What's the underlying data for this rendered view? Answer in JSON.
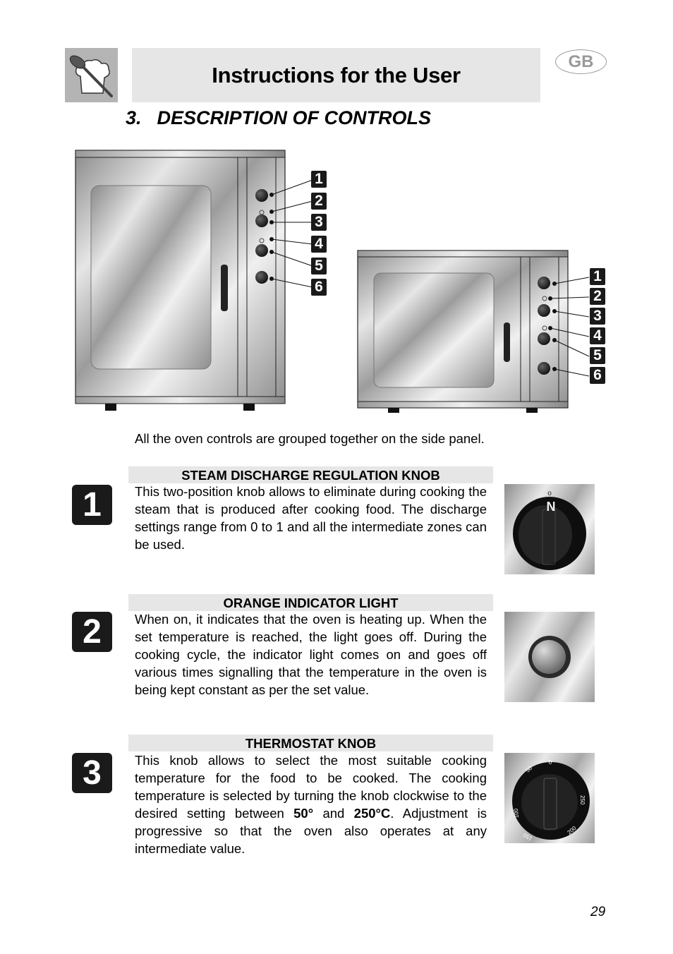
{
  "header": {
    "title": "Instructions for the User",
    "language_badge": "GB",
    "logo_icon": "chef-hat-spoon-icon"
  },
  "section": {
    "number": "3.",
    "title": "DESCRIPTION OF CONTROLS"
  },
  "figures": {
    "large_oven": {
      "callouts": [
        "1",
        "2",
        "3",
        "4",
        "5",
        "6"
      ]
    },
    "small_oven": {
      "callouts": [
        "1",
        "2",
        "3",
        "4",
        "5",
        "6"
      ]
    }
  },
  "intro": "All the oven controls are grouped together on the side panel.",
  "items": [
    {
      "number": "1",
      "heading": "STEAM DISCHARGE REGULATION KNOB",
      "body": "This two-position knob allows to eliminate during cooking the steam that is produced after cooking food. The discharge settings range from 0 to 1 and all the intermediate zones can be used.",
      "image_icon": "steam-knob-icon"
    },
    {
      "number": "2",
      "heading": "ORANGE INDICATOR LIGHT",
      "body": "When on, it indicates that the oven is heating up. When the set temperature is reached, the light goes off. During the cooking cycle, the indicator light comes on and goes off various times signalling that the temperature in the oven is being kept constant as per the set value.",
      "image_icon": "indicator-light-icon"
    },
    {
      "number": "3",
      "heading": "THERMOSTAT KNOB",
      "body_parts": {
        "a": "This knob allows to select the most suitable cooking temperature for the food to be cooked. The cooking temperature is selected by turning the knob clockwise to the desired setting between ",
        "min": "50°",
        "mid": " and ",
        "max": "250°C",
        "b": ". Adjustment is progressive so that the oven also operates at any intermediate value."
      },
      "image_icon": "thermostat-knob-icon",
      "knob_labels": [
        "0",
        "50",
        "100",
        "150",
        "200",
        "250"
      ]
    }
  ],
  "page_number": "29"
}
